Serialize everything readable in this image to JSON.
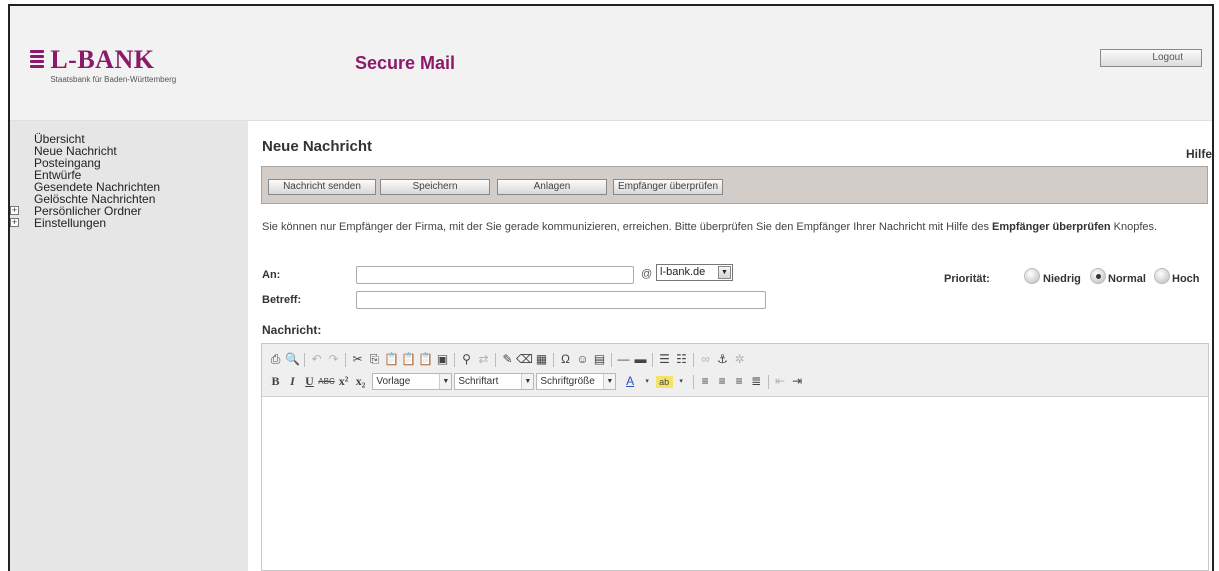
{
  "header": {
    "logo_text": "L-BANK",
    "logo_subtitle": "Staatsbank für Baden-Württemberg",
    "app_title": "Secure Mail",
    "logout_label": "Logout"
  },
  "sidebar": {
    "items": [
      {
        "label": "Übersicht",
        "expandable": false
      },
      {
        "label": "Neue Nachricht",
        "expandable": false
      },
      {
        "label": "Posteingang",
        "expandable": false
      },
      {
        "label": "Entwürfe",
        "expandable": false
      },
      {
        "label": "Gesendete Nachrichten",
        "expandable": false
      },
      {
        "label": "Gelöschte Nachrichten",
        "expandable": false
      },
      {
        "label": "Persönlicher Ordner",
        "expandable": true
      },
      {
        "label": "Einstellungen",
        "expandable": true
      }
    ]
  },
  "main": {
    "title": "Neue Nachricht",
    "help_label": "Hilfe",
    "toolbar": {
      "send_label": "Nachricht senden",
      "save_label": "Speichern",
      "attachments_label": "Anlagen",
      "check_recipient_label": "Empfänger überprüfen"
    },
    "info_text": "Sie können nur Empfänger der Firma, mit der Sie gerade kommunizieren, erreichen. Bitte überprüfen Sie den Empfänger Ihrer Nachricht mit Hilfe des ",
    "info_bold": "Empfänger überprüfen",
    "info_end": " Knopfes.",
    "form": {
      "to_label": "An:",
      "to_value": "",
      "at_sign": "@",
      "domain_selected": "l-bank.de",
      "subject_label": "Betreff:",
      "subject_value": "",
      "priority_label": "Priorität:",
      "priority_options": [
        "Niedrig",
        "Normal",
        "Hoch"
      ],
      "priority_selected": "Normal",
      "message_label": "Nachricht:"
    },
    "editor": {
      "style_combo": "Vorlage",
      "font_combo": "Schriftart",
      "size_combo": "Schriftgröße",
      "body_text": ""
    }
  }
}
